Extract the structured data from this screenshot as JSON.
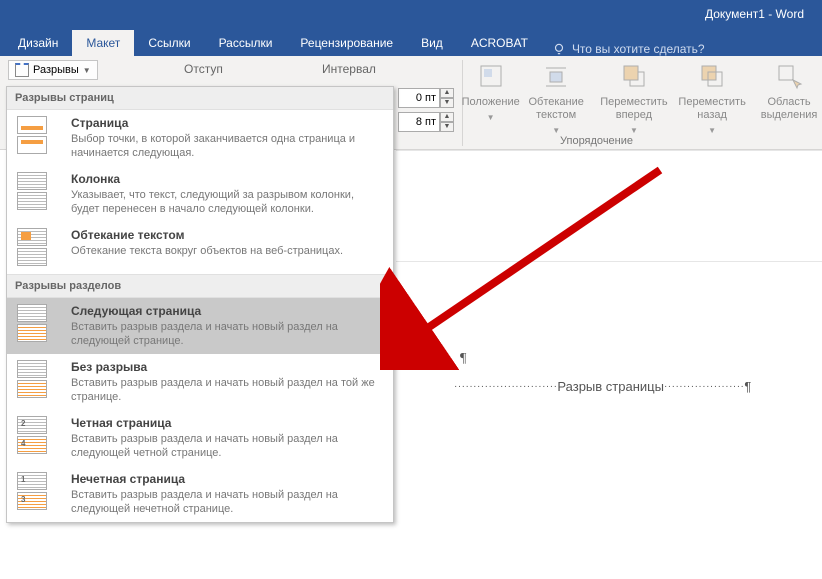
{
  "title": "Документ1 - Word",
  "tabs": {
    "design": "Дизайн",
    "layout": "Макет",
    "links": "Ссылки",
    "mailings": "Рассылки",
    "review": "Рецензирование",
    "view": "Вид",
    "acrobat": "ACROBAT",
    "tellme": "Что вы хотите сделать?"
  },
  "breaks_button": "Разрывы",
  "indent_label": "Отступ",
  "spacing_label": "Интервал",
  "spacing_before": "0 пт",
  "spacing_after": "8 пт",
  "arrange": {
    "position": "Положение",
    "wrap": "Обтекание текстом",
    "forward": "Переместить вперед",
    "backward": "Переместить назад",
    "selection": "Область выделения",
    "group_label": "Упорядочение"
  },
  "menu": {
    "page_breaks_header": "Разрывы страниц",
    "section_breaks_header": "Разрывы разделов",
    "page": {
      "title": "Страница",
      "desc": "Выбор точки, в которой заканчивается одна страница и начинается следующая."
    },
    "column": {
      "title": "Колонка",
      "desc": "Указывает, что текст, следующий за разрывом колонки, будет перенесен в начало следующей колонки."
    },
    "textwrap": {
      "title": "Обтекание текстом",
      "desc": "Обтекание текста вокруг объектов на веб-страницах."
    },
    "nextpage": {
      "title": "Следующая страница",
      "desc": "Вставить разрыв раздела и начать новый раздел на следующей странице."
    },
    "continuous": {
      "title": "Без разрыва",
      "desc": "Вставить разрыв раздела и начать новый раздел на той же странице."
    },
    "evenpage": {
      "title": "Четная страница",
      "desc": "Вставить разрыв раздела и начать новый раздел на следующей четной странице."
    },
    "oddpage": {
      "title": "Нечетная страница",
      "desc": "Вставить разрыв раздела и начать новый раздел на следующей нечетной странице."
    }
  },
  "document": {
    "pilcrow": "¶",
    "page_break_text": "Разрыв страницы"
  }
}
